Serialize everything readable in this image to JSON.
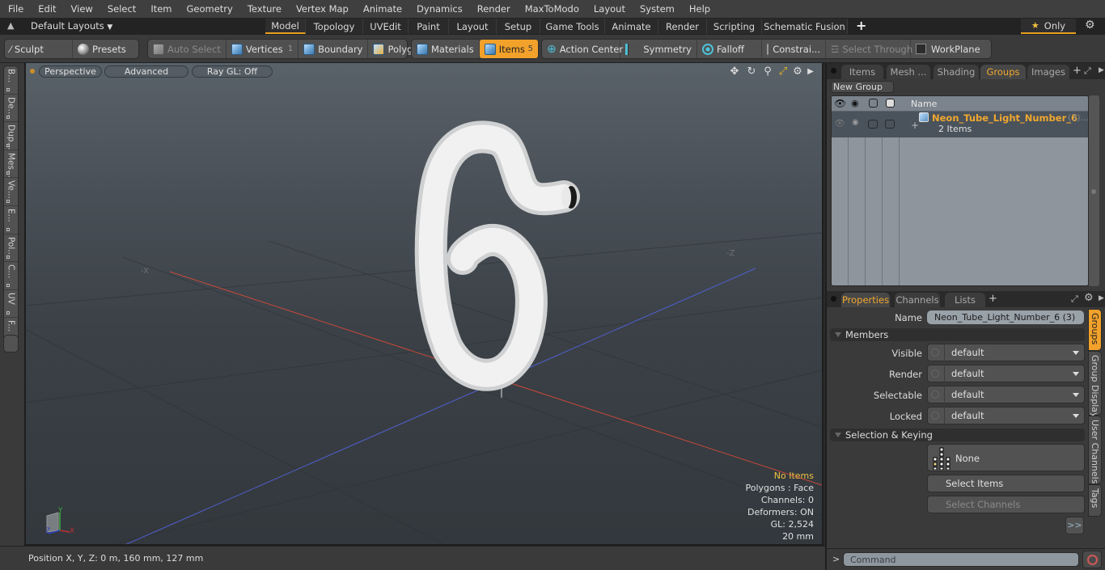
{
  "menu": [
    "File",
    "Edit",
    "View",
    "Select",
    "Item",
    "Geometry",
    "Texture",
    "Vertex Map",
    "Animate",
    "Dynamics",
    "Render",
    "MaxToModo",
    "Layout",
    "System",
    "Help"
  ],
  "layoutbar": {
    "layouts_label": "Default Layouts",
    "tabs": [
      "Model",
      "Topology",
      "UVEdit",
      "Paint",
      "Layout",
      "Setup",
      "Game Tools",
      "Animate",
      "Render",
      "Scripting",
      "Schematic Fusion"
    ],
    "active_tab": "Model",
    "add_label": "+",
    "only_label": "Only"
  },
  "toolbar": {
    "sculpt": "Sculpt",
    "presets": "Presets",
    "auto_select": "Auto Select",
    "vertices": "Vertices",
    "vertices_count": "1",
    "boundary": "Boundary",
    "polygons": "Polygons",
    "materials": "Materials",
    "items": "Items",
    "items_count": "5",
    "action_center": "Action Center",
    "symmetry": "Symmetry",
    "falloff": "Falloff",
    "constraints": "Constrai...",
    "select_through": "Select Through",
    "workplane": "WorkPlane"
  },
  "left_tabs": [
    "B...",
    "De...",
    "Dup...",
    "Mes...",
    "Ve...",
    "E...",
    "Pol...",
    "C...",
    "UV",
    "F..."
  ],
  "viewport": {
    "perspective": "Perspective",
    "advanced": "Advanced",
    "raygl": "Ray GL: Off",
    "axis_neg_x": "-X",
    "axis_neg_z": "-Z",
    "stats": {
      "no_items": "No Items",
      "polygons": "Polygons : Face",
      "channels": "Channels: 0",
      "deformers": "Deformers: ON",
      "gl": "GL: 2,524",
      "scale": "20 mm"
    },
    "gizmo": {
      "x": "X",
      "y": "Y",
      "z": "Z"
    }
  },
  "statusbar": {
    "position": "Position X, Y, Z:   0 m, 160 mm, 127 mm"
  },
  "groups_panel": {
    "tabs": [
      "Items",
      "Mesh ...",
      "Shading",
      "Groups",
      "Images"
    ],
    "active_tab": "Groups",
    "new_group": "New Group",
    "col_name": "Name",
    "group": {
      "name": "Neon_Tube_Light_Number_6",
      "suffix": "(3)...",
      "sub": "2 Items"
    }
  },
  "properties_panel": {
    "tabs": [
      "Properties",
      "Channels",
      "Lists"
    ],
    "active_tab": "Properties",
    "name_label": "Name",
    "name_value": "Neon_Tube_Light_Number_6 (3)",
    "members_section": "Members",
    "fields": [
      {
        "label": "Visible",
        "value": "default"
      },
      {
        "label": "Render",
        "value": "default"
      },
      {
        "label": "Selectable",
        "value": "default"
      },
      {
        "label": "Locked",
        "value": "default"
      }
    ],
    "selection_section": "Selection & Keying",
    "none_label": "None",
    "select_items": "Select Items",
    "select_channels": "Select Channels",
    "more": ">>",
    "side_tabs": [
      "Groups",
      "Group Display",
      "User Channels",
      "Tags"
    ]
  },
  "command": {
    "prompt": ">",
    "placeholder": "Command"
  },
  "colors": {
    "accent": "#f2a12a",
    "group_name": "#f0a830",
    "stat_highlight": "#f0c040",
    "x_axis": "#c8483a",
    "z_axis": "#5060d0"
  }
}
